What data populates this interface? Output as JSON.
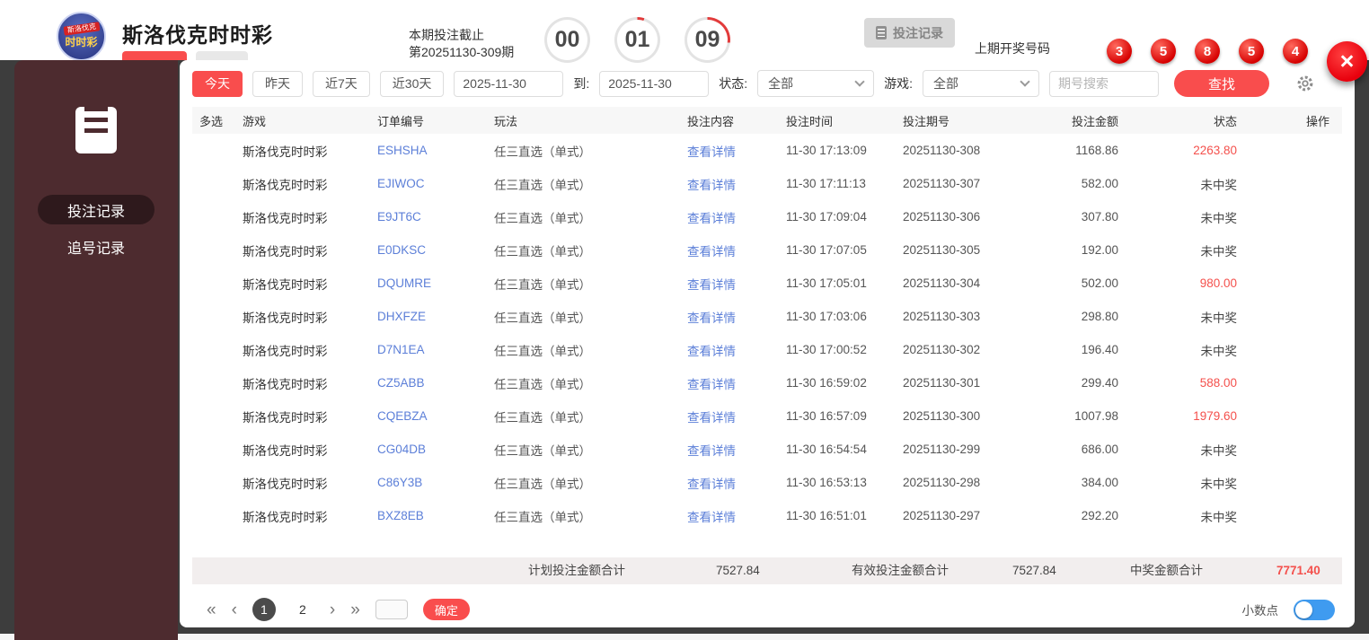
{
  "colors": {
    "accent": "#f94d4d",
    "link": "#5c7fd8",
    "win": "#f4504c",
    "sidebar_bg": "#4d2b2f",
    "toggle_on": "#3f9bf0",
    "ball": "#d60000",
    "close": "#e8000d"
  },
  "header": {
    "logo": {
      "line1": "斯洛伐克",
      "line2": "时时彩"
    },
    "site_title": "斯洛伐克时时彩",
    "deadline_label": "本期投注截止",
    "period_text": "第20251130-309期",
    "countdown": {
      "h": "00",
      "m": "01",
      "s": "09"
    },
    "records_button": "投注记录",
    "last_draw_label": "上期开奖号码",
    "last_draw_numbers": [
      "3",
      "5",
      "8",
      "5",
      "4"
    ],
    "close_glyph": "×"
  },
  "sidebar": {
    "items": [
      {
        "label": "投注记录",
        "active": true
      },
      {
        "label": "追号记录",
        "active": false
      }
    ]
  },
  "filters": {
    "quick": [
      "今天",
      "昨天",
      "近7天",
      "近30天"
    ],
    "date_from": "2025-11-30",
    "to_label": "到:",
    "date_to": "2025-11-30",
    "status_label": "状态:",
    "status_value": "全部",
    "game_label": "游戏:",
    "game_value": "全部",
    "search_placeholder": "期号搜索",
    "search_button": "查找"
  },
  "table": {
    "headers": [
      "多选",
      "游戏",
      "订单编号",
      "玩法",
      "投注内容",
      "投注时间",
      "投注期号",
      "投注金额",
      "状态",
      "操作"
    ],
    "rows": [
      {
        "game": "斯洛伐克时时彩",
        "order": "ESHSHA",
        "play": "任三直选（单式）",
        "content": "查看详情",
        "time": "11-30 17:13:09",
        "period": "20251130-308",
        "amount": "1168.86",
        "status": "2263.80",
        "won": true
      },
      {
        "game": "斯洛伐克时时彩",
        "order": "EJIWOC",
        "play": "任三直选（单式）",
        "content": "查看详情",
        "time": "11-30 17:11:13",
        "period": "20251130-307",
        "amount": "582.00",
        "status": "未中奖",
        "won": false
      },
      {
        "game": "斯洛伐克时时彩",
        "order": "E9JT6C",
        "play": "任三直选（单式）",
        "content": "查看详情",
        "time": "11-30 17:09:04",
        "period": "20251130-306",
        "amount": "307.80",
        "status": "未中奖",
        "won": false
      },
      {
        "game": "斯洛伐克时时彩",
        "order": "E0DKSC",
        "play": "任三直选（单式）",
        "content": "查看详情",
        "time": "11-30 17:07:05",
        "period": "20251130-305",
        "amount": "192.00",
        "status": "未中奖",
        "won": false
      },
      {
        "game": "斯洛伐克时时彩",
        "order": "DQUMRE",
        "play": "任三直选（单式）",
        "content": "查看详情",
        "time": "11-30 17:05:01",
        "period": "20251130-304",
        "amount": "502.00",
        "status": "980.00",
        "won": true
      },
      {
        "game": "斯洛伐克时时彩",
        "order": "DHXFZE",
        "play": "任三直选（单式）",
        "content": "查看详情",
        "time": "11-30 17:03:06",
        "period": "20251130-303",
        "amount": "298.80",
        "status": "未中奖",
        "won": false
      },
      {
        "game": "斯洛伐克时时彩",
        "order": "D7N1EA",
        "play": "任三直选（单式）",
        "content": "查看详情",
        "time": "11-30 17:00:52",
        "period": "20251130-302",
        "amount": "196.40",
        "status": "未中奖",
        "won": false
      },
      {
        "game": "斯洛伐克时时彩",
        "order": "CZ5ABB",
        "play": "任三直选（单式）",
        "content": "查看详情",
        "time": "11-30 16:59:02",
        "period": "20251130-301",
        "amount": "299.40",
        "status": "588.00",
        "won": true
      },
      {
        "game": "斯洛伐克时时彩",
        "order": "CQEBZA",
        "play": "任三直选（单式）",
        "content": "查看详情",
        "time": "11-30 16:57:09",
        "period": "20251130-300",
        "amount": "1007.98",
        "status": "1979.60",
        "won": true
      },
      {
        "game": "斯洛伐克时时彩",
        "order": "CG04DB",
        "play": "任三直选（单式）",
        "content": "查看详情",
        "time": "11-30 16:54:54",
        "period": "20251130-299",
        "amount": "686.00",
        "status": "未中奖",
        "won": false
      },
      {
        "game": "斯洛伐克时时彩",
        "order": "C86Y3B",
        "play": "任三直选（单式）",
        "content": "查看详情",
        "time": "11-30 16:53:13",
        "period": "20251130-298",
        "amount": "384.00",
        "status": "未中奖",
        "won": false
      },
      {
        "game": "斯洛伐克时时彩",
        "order": "BXZ8EB",
        "play": "任三直选（单式）",
        "content": "查看详情",
        "time": "11-30 16:51:01",
        "period": "20251130-297",
        "amount": "292.20",
        "status": "未中奖",
        "won": false
      }
    ]
  },
  "summary": {
    "planned_label": "计划投注金额合计",
    "planned_value": "7527.84",
    "valid_label": "有效投注金额合计",
    "valid_value": "7527.84",
    "win_label": "中奖金额合计",
    "win_value": "7771.40"
  },
  "pagination": {
    "first": "«",
    "prev": "‹",
    "pages": [
      {
        "label": "1",
        "active": true
      },
      {
        "label": "2",
        "active": false
      }
    ],
    "next": "›",
    "last": "»",
    "confirm": "确定",
    "decimal_label": "小数点"
  }
}
